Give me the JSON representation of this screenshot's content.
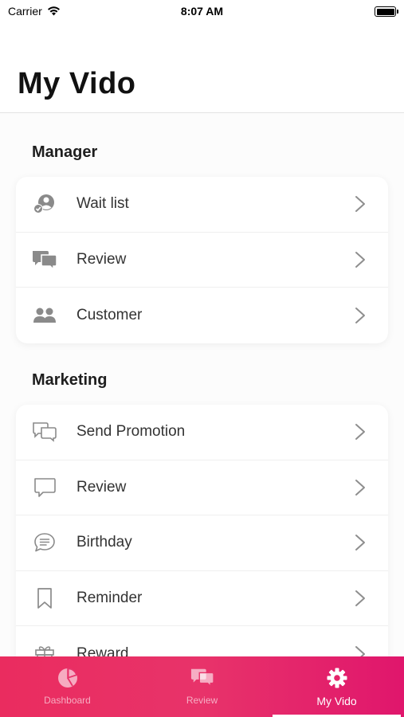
{
  "status_bar": {
    "carrier": "Carrier",
    "time": "8:07 AM"
  },
  "page": {
    "title": "My Vido"
  },
  "sections": [
    {
      "title": "Manager",
      "items": [
        {
          "label": "Wait list",
          "icon": "wait-list-icon"
        },
        {
          "label": "Review",
          "icon": "chat-bubbles-icon"
        },
        {
          "label": "Customer",
          "icon": "users-icon"
        }
      ]
    },
    {
      "title": "Marketing",
      "items": [
        {
          "label": "Send Promotion",
          "icon": "chat-outline-icon"
        },
        {
          "label": "Review",
          "icon": "speech-bubble-icon"
        },
        {
          "label": "Birthday",
          "icon": "message-circle-icon"
        },
        {
          "label": "Reminder",
          "icon": "bookmark-icon"
        },
        {
          "label": "Reward",
          "icon": "gift-icon"
        }
      ]
    }
  ],
  "tabs": [
    {
      "label": "Dashboard",
      "icon": "pie-chart-icon",
      "active": false
    },
    {
      "label": "Review",
      "icon": "chat-bubbles-icon",
      "active": false
    },
    {
      "label": "My Vido",
      "icon": "gear-icon",
      "active": true
    }
  ],
  "colors": {
    "accent": "#e8336a",
    "icon_gray": "#7a7a7a",
    "chevron": "#8e8e8e"
  }
}
